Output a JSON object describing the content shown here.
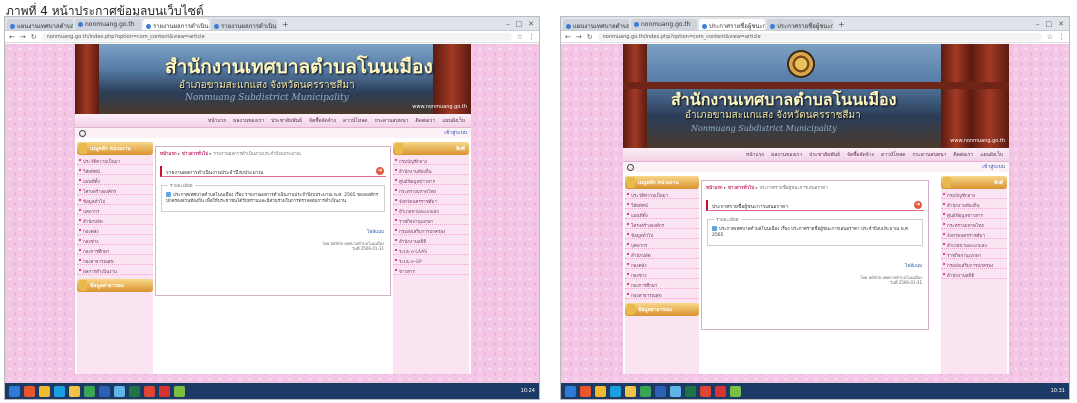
{
  "page_heading": "ภาพที่ 4 หน้าประกาศข้อมูลบนเว็บไซต์",
  "screens": [
    {
      "tabs": [
        {
          "label": "แผนงานเทศบาลตำบลโนนเมือง"
        },
        {
          "label": "nonmuang.go.th"
        },
        {
          "label": "รายงานผลการดำเนินงาน"
        },
        {
          "label": "รายงานผลการดำเนินงาน"
        }
      ],
      "url": "nonmuang.go.th/index.php?option=com_content&view=article",
      "site_title": "สำนักงานเทศบาลตำบลโนนเมือง",
      "site_subtitle": "อำเภอขามสะแกแสง จังหวัดนครราชสีมา",
      "site_en": "Nonmuang Subdistrict Municipality",
      "site_url": "www.nonmuang.go.th",
      "nav": [
        "หน้าแรก",
        "ผลงานของเรา",
        "ประชาสัมพันธ์",
        "จัดซื้อจัดจ้าง",
        "ดาวน์โหลด",
        "กระดานสนทนา",
        "ติดต่อเรา",
        "แผนผังเว็บ"
      ],
      "login": "เข้าสู่ระบบ",
      "left_head": "เมนูหลัก หน่วยงาน",
      "left_items": [
        "ประวัติความเป็นมา",
        "วิสัยทัศน์",
        "แผนที่ตั้ง",
        "โครงสร้างองค์กร",
        "ข้อมูลทั่วไป",
        "บุคลากร",
        "สำนักปลัด",
        "กองคลัง",
        "กองช่าง",
        "กองการศึกษา",
        "กองสาธารณสุข",
        "ผลการดำเนินงาน"
      ],
      "left_head2": "ข้อมูลสาธารณะ",
      "right_head": "ลิงค์",
      "right_items": [
        "กรมบัญชีกลาง",
        "สำนักงานท้องถิ่น",
        "ศูนย์ข้อมูลข่าวสาร",
        "กระทรวงมหาดไทย",
        "จังหวัดนครราชสีมา",
        "อำเภอขามสะแกแสง",
        "ราชกิจจานุเบกษา",
        "กรมส่งเสริมการปกครอง",
        "สำนักงานสถิติ",
        "ระบบ e-LAAS",
        "ระบบ e-GP",
        "ข่าวสาร"
      ],
      "breadcrumb_home": "หน้าแรก",
      "breadcrumb_mid": "ข่าวสารทั่วไป",
      "breadcrumb_last": "รายงานผลการดำเนินงานประจำปีงบประมาณ",
      "section_title": "รายงานผลการดำเนินงานประจำปีงบประมาณ",
      "legend": "รายละเอียด",
      "notice_text": "ประกาศเทศบาลตำบลโนนเมือง เรื่อง รายงานผลการดำเนินงานประจำปีงบประมาณ พ.ศ. 2565 ขององค์กรปกครองส่วนท้องถิ่น เพื่อให้ประชาชนได้รับทราบและมีส่วนร่วมในการตรวจสอบการดำเนินงาน",
      "readmore": "ไฟล์แนบ",
      "meta_author": "โดย admin เทศบาลตำบลโนนเมือง",
      "meta_date": "วันที่ 2566-01-31",
      "clock": "10:24"
    },
    {
      "tabs": [
        {
          "label": "แผนงานเทศบาลตำบลโนนเมือง"
        },
        {
          "label": "nonmuang.go.th"
        },
        {
          "label": "ประกาศรายชื่อผู้ชนะการเสนอราคา"
        },
        {
          "label": "ประกาศรายชื่อผู้ชนะการเสนอราคา"
        }
      ],
      "url": "nonmuang.go.th/index.php?option=com_content&view=article",
      "site_title": "สำนักงานเทศบาลตำบลโนนเมือง",
      "site_subtitle": "อำเภอขามสะแกแสง จังหวัดนครราชสีมา",
      "site_en": "Nonmuang Subdistrict Municipality",
      "site_url": "www.nonmuang.go.th",
      "nav": [
        "หน้าแรก",
        "ผลงานของเรา",
        "ประชาสัมพันธ์",
        "จัดซื้อจัดจ้าง",
        "ดาวน์โหลด",
        "กระดานสนทนา",
        "ติดต่อเรา",
        "แผนผังเว็บ"
      ],
      "login": "เข้าสู่ระบบ",
      "left_head": "เมนูหลัก หน่วยงาน",
      "left_items": [
        "ประวัติความเป็นมา",
        "วิสัยทัศน์",
        "แผนที่ตั้ง",
        "โครงสร้างองค์กร",
        "ข้อมูลทั่วไป",
        "บุคลากร",
        "สำนักปลัด",
        "กองคลัง",
        "กองช่าง",
        "กองการศึกษา",
        "กองสาธารณสุข"
      ],
      "left_head2": "ข้อมูลสาธารณะ",
      "right_head": "ลิงค์",
      "right_items": [
        "กรมบัญชีกลาง",
        "สำนักงานท้องถิ่น",
        "ศูนย์ข้อมูลข่าวสาร",
        "กระทรวงมหาดไทย",
        "จังหวัดนครราชสีมา",
        "อำเภอขามสะแกแสง",
        "ราชกิจจานุเบกษา",
        "กรมส่งเสริมการปกครอง",
        "สำนักงานสถิติ"
      ],
      "breadcrumb_home": "หน้าแรก",
      "breadcrumb_mid": "ข่าวสารทั่วไป",
      "breadcrumb_last": "ประกาศรายชื่อผู้ชนะการเสนอราคา",
      "section_title": "ประกาศรายชื่อผู้ชนะการเสนอราคา",
      "legend": "รายละเอียด",
      "notice_text": "ประกาศเทศบาลตำบลโนนเมือง เรื่อง ประกาศรายชื่อผู้ชนะการเสนอราคา ประจำปีงบประมาณ พ.ศ. 2565",
      "readmore": "ไฟล์แนบ",
      "meta_author": "โดย admin เทศบาลตำบลโนนเมือง",
      "meta_date": "วันที่ 2566-01-31",
      "clock": "10:31"
    }
  ],
  "colors": {
    "page_background": "#f3c6e6",
    "menu_head": "#d9912e",
    "accent_red": "#c8102e",
    "taskbar": "#1b3a66",
    "link_blue": "#2b4fa8"
  },
  "taskbar_icons": [
    {
      "name": "start-icon",
      "color": "#2e7bd6"
    },
    {
      "name": "firefox-icon",
      "color": "#e8562a"
    },
    {
      "name": "chrome-icon",
      "color": "#f1b92f"
    },
    {
      "name": "skype-icon",
      "color": "#1aa0e0"
    },
    {
      "name": "folder-icon",
      "color": "#f0c24a"
    },
    {
      "name": "app-icon",
      "color": "#3aa655"
    },
    {
      "name": "word-icon",
      "color": "#2b5fb8"
    },
    {
      "name": "photos-icon",
      "color": "#5fb5e8"
    },
    {
      "name": "excel-icon",
      "color": "#217346"
    },
    {
      "name": "chrome-icon",
      "color": "#e04434"
    },
    {
      "name": "opera-icon",
      "color": "#d63333"
    },
    {
      "name": "notes-icon",
      "color": "#7bbf44"
    }
  ]
}
